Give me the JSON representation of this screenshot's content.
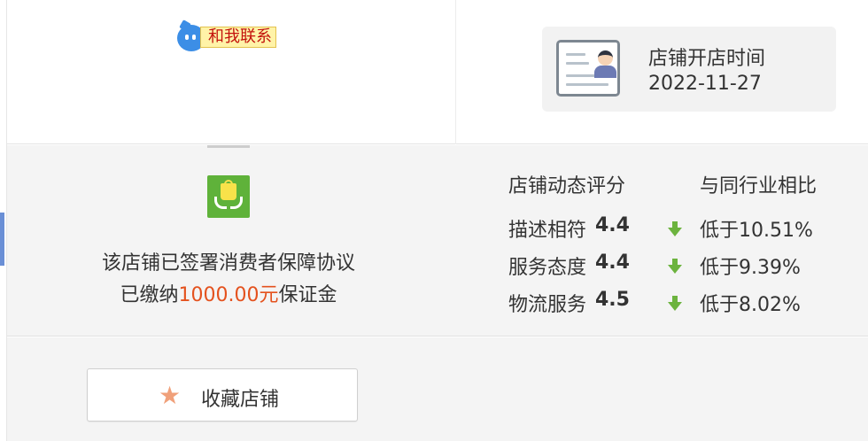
{
  "contact": {
    "label": "和我联系"
  },
  "shop_open": {
    "title": "店铺开店时间",
    "date": "2022-11-27"
  },
  "guarantee": {
    "line1": "该店铺已签署消费者保障协议",
    "line2_prefix": "已缴纳",
    "amount": "1000.00元",
    "line2_suffix": "保证金"
  },
  "ratings": {
    "title": "店铺动态评分",
    "compare_title": "与同行业相比",
    "rows": [
      {
        "label": "描述相符",
        "score": "4.4",
        "compare": "低于10.51%"
      },
      {
        "label": "服务态度",
        "score": "4.4",
        "compare": "低于9.39%"
      },
      {
        "label": "物流服务",
        "score": "4.5",
        "compare": "低于8.02%"
      }
    ]
  },
  "favorite": {
    "label": "收藏店铺"
  },
  "colors": {
    "accent_orange": "#e4521e",
    "down_green": "#6cb33e",
    "contact_red": "#c3120c"
  },
  "icons": [
    "chat-bubble-icon",
    "id-card-icon",
    "guarantee-shield-icon",
    "down-arrow-icon",
    "star-icon"
  ]
}
